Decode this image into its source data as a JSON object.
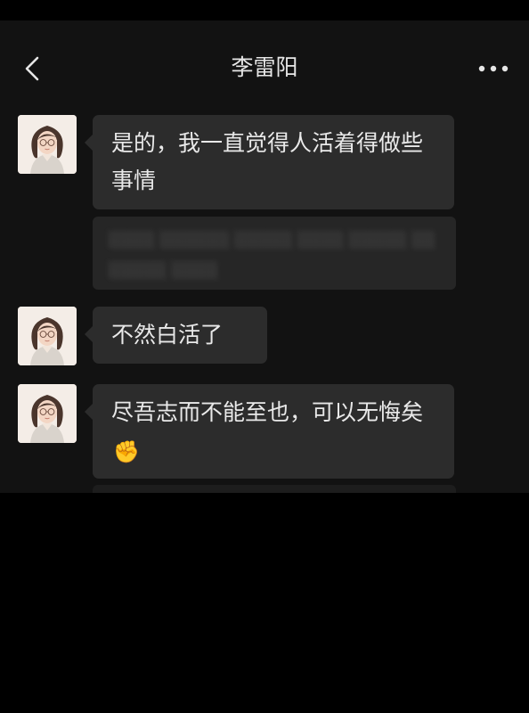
{
  "header": {
    "title": "李雷阳",
    "back_icon": "chevron-left-icon",
    "more_icon": "more-horizontal-icon"
  },
  "messages": [
    {
      "text": "是的，我一直觉得人活着得做些事情"
    },
    {
      "text": "不然白活了"
    },
    {
      "text": "尽吾志而不能至也，可以无悔矣",
      "emoji": "✊"
    }
  ],
  "colors": {
    "background": "#121212",
    "bubble": "#2c2c2c",
    "text": "#e9e9e9"
  }
}
